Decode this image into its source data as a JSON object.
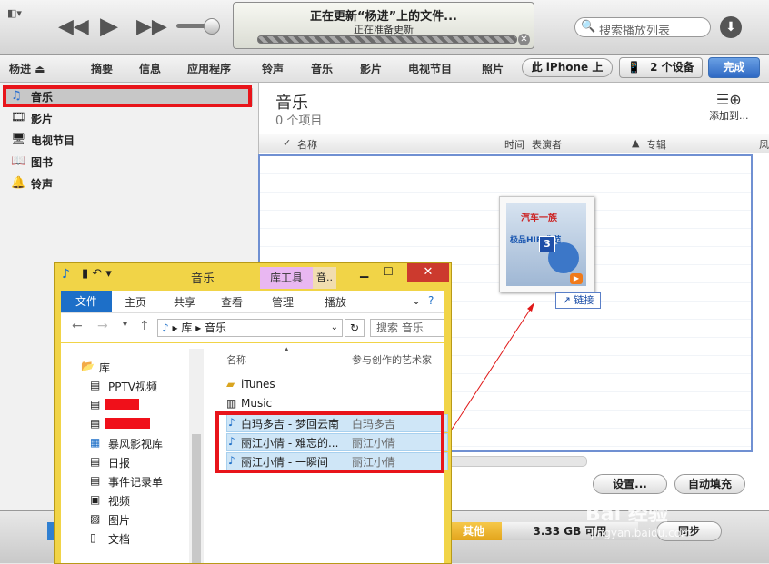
{
  "toolbar": {
    "status_title": "正在更新“杨进”上的文件...",
    "status_sub": "正在准备更新",
    "search_placeholder": "搜索播放列表"
  },
  "nav": {
    "device_name": "杨进",
    "tabs": [
      "摘要",
      "信息",
      "应用程序",
      "铃声",
      "音乐",
      "影片",
      "电视节目",
      "照片"
    ],
    "on_iphone": "此 iPhone 上",
    "devices": "2 个设备",
    "done": "完成"
  },
  "sidebar": {
    "items": [
      {
        "label": "音乐",
        "icon": "music-note-icon"
      },
      {
        "label": "影片",
        "icon": "film-icon"
      },
      {
        "label": "电视节目",
        "icon": "tv-icon"
      },
      {
        "label": "图书",
        "icon": "book-icon"
      },
      {
        "label": "铃声",
        "icon": "bell-icon"
      }
    ]
  },
  "main": {
    "title": "音乐",
    "count": "0 个项目",
    "add_to": "添加到...",
    "columns": [
      "名称",
      "时间",
      "表演者",
      "专辑",
      "风"
    ]
  },
  "buttons": {
    "settings": "设置...",
    "autofill": "自动填充",
    "sync": "同步"
  },
  "capacity": {
    "other_label": "其他",
    "free_label": "3.33 GB 可用"
  },
  "drag": {
    "badge": "3",
    "link_label": "链接",
    "album_line1": "汽车一族",
    "album_line2": "极品HIFI典范"
  },
  "explorer": {
    "title": "音乐",
    "library_tools": "库工具",
    "music_tab": "音..",
    "ribbon_tabs": [
      "文件",
      "主页",
      "共享",
      "查看",
      "管理",
      "播放"
    ],
    "breadcrumb": [
      "库",
      "音乐"
    ],
    "search_placeholder": "搜索 音乐",
    "tree": [
      "库",
      "PPTV视频",
      "暴风影视库",
      "日报",
      "事件记录单",
      "视频",
      "图片",
      "文档"
    ],
    "columns": [
      "名称",
      "参与创作的艺术家"
    ],
    "files": [
      {
        "name": "iTunes",
        "artist": ""
      },
      {
        "name": "Music",
        "artist": ""
      },
      {
        "name": "白玛多吉 - 梦回云南",
        "artist": "白玛多吉"
      },
      {
        "name": "丽江小倩 - 难忘的...",
        "artist": "丽江小倩"
      },
      {
        "name": "丽江小倩 - 一瞬间",
        "artist": "丽江小倩"
      }
    ]
  },
  "watermark": {
    "main": "Bai 经验",
    "sub": "jingyan.baidu.com"
  }
}
